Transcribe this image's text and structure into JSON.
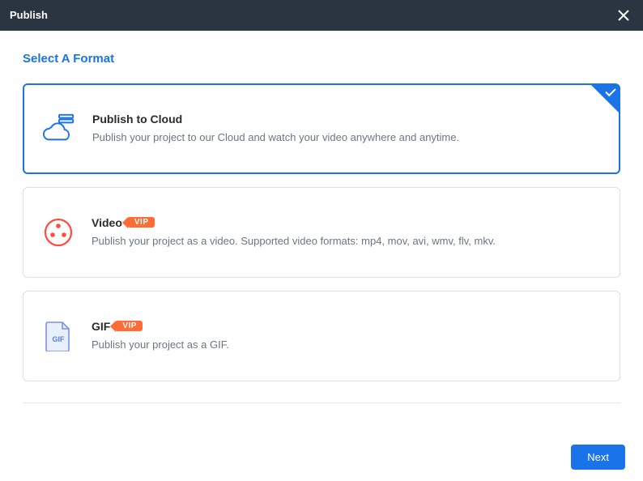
{
  "titlebar": {
    "title": "Publish"
  },
  "heading": "Select A Format",
  "options": {
    "cloud": {
      "title": "Publish to Cloud",
      "desc": "Publish your project to our Cloud and watch your video anywhere and anytime."
    },
    "video": {
      "title": "Video",
      "vip": "VIP",
      "desc": "Publish your project as a video. Supported video formats: mp4, mov, avi, wmv, flv, mkv."
    },
    "gif": {
      "title": "GIF",
      "vip": "VIP",
      "desc": "Publish your project as a GIF.",
      "icon_text": "GIF"
    }
  },
  "footer": {
    "next": "Next"
  }
}
